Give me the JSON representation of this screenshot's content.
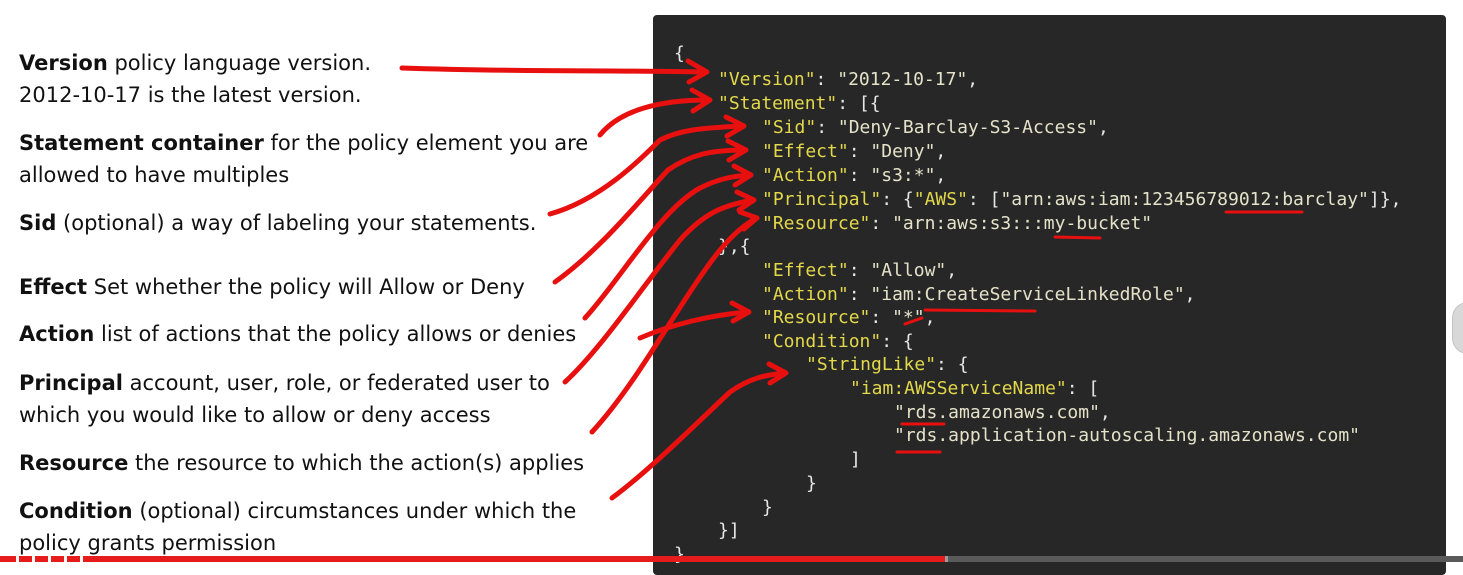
{
  "labels": [
    {
      "term": "Version",
      "rest": " policy language version.",
      "line2": "2012-10-17 is the latest version."
    },
    {
      "term": "Statement container",
      "rest": " for the policy element you are",
      "line2": "allowed to have multiples"
    },
    {
      "term": "Sid",
      "rest": " (optional) a way of labeling your statements."
    },
    {
      "term": "Effect",
      "rest": " Set whether the policy will  Allow or Deny"
    },
    {
      "term": "Action",
      "rest": " list of actions that the policy allows or denies"
    },
    {
      "term": "Principal",
      "rest": " account, user, role, or federated user to",
      "line2": "which you would like to allow or deny access"
    },
    {
      "term": "Resource",
      "rest": "  the resource to which the action(s) applies"
    },
    {
      "term": "Condition",
      "rest": " (optional) circumstances under which the",
      "line2": "policy grants permission"
    }
  ],
  "code": {
    "open_brace": "{",
    "version_key": "\"Version\"",
    "version_value": "\"2012-10-17\"",
    "statement_key": "\"Statement\"",
    "statement_open": ": [{",
    "statements": [
      {
        "sid_key": "\"Sid\"",
        "sid_value": "\"Deny-Barclay-S3-Access\"",
        "effect_key": "\"Effect\"",
        "effect_value": "\"Deny\"",
        "action_key": "\"Action\"",
        "action_value": "\"s3:*\"",
        "principal_key": "\"Principal\"",
        "principal_open": ": {",
        "aws_key": "\"AWS\"",
        "aws_value": "\"arn:aws:iam:123456789012:barclay\"",
        "principal_close": "]},",
        "resource_key": "\"Resource\"",
        "resource_value": "\"arn:aws:s3:::my-bucket\""
      },
      {
        "effect_key": "\"Effect\"",
        "effect_value": "\"Allow\"",
        "action_key": "\"Action\"",
        "action_value": "\"iam:CreateServiceLinkedRole\"",
        "resource_key": "\"Resource\"",
        "resource_value": "\"*\"",
        "condition_key": "\"Condition\"",
        "stringlike_key": "\"StringLike\"",
        "service_key": "\"iam:AWSServiceName\"",
        "service_values": [
          "\"rds.amazonaws.com\"",
          "\"rds.application-autoscaling.amazonaws.com\""
        ]
      }
    ],
    "between_statements": "},{",
    "close_array_bracket": "]",
    "close_brace": "}",
    "close_statements": "}]",
    "final_brace": "}"
  },
  "colors": {
    "code_background": "#272727",
    "json_key": "#e3d84a",
    "json_string": "#e4e2c8",
    "punctuation": "#e6e6e6",
    "annotation_red": "#e8100f",
    "progress_red": "#e61b1b"
  },
  "video": {
    "progress_fraction": 0.646
  }
}
